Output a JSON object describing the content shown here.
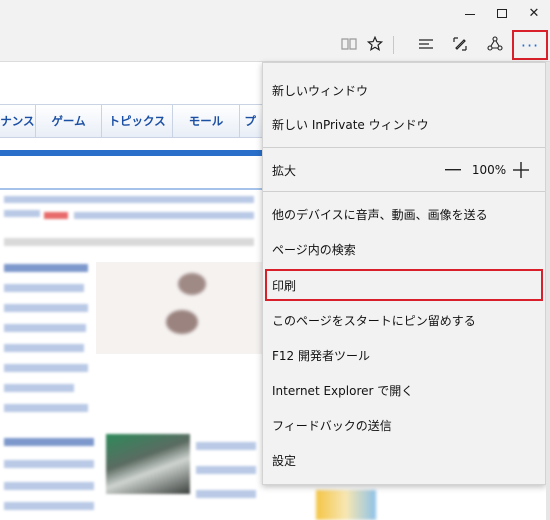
{
  "browser": {
    "window_controls": {
      "minimize": "—",
      "maximize": "□",
      "close": "✕"
    },
    "toolbar": {
      "icons": [
        "reading-view-icon",
        "favorite-star-icon",
        "hub-icon",
        "web-note-icon",
        "share-icon",
        "more-icon"
      ],
      "more_label": "···"
    }
  },
  "page": {
    "nav_tabs": [
      {
        "label": "ナンス"
      },
      {
        "label": "ゲーム"
      },
      {
        "label": "トピックス"
      },
      {
        "label": "モール"
      },
      {
        "label": "プ"
      }
    ]
  },
  "menu": {
    "new_window": "新しいウィンドウ",
    "new_inprivate": "新しい InPrivate ウィンドウ",
    "zoom": {
      "label": "拡大",
      "value": "100%",
      "minus": "—",
      "plus": "+"
    },
    "cast": "他のデバイスに音声、動画、画像を送る",
    "find": "ページ内の検索",
    "print": "印刷",
    "pin": "このページをスタートにピン留めする",
    "devtools": "F12 開発者ツール",
    "open_ie": "Internet Explorer で開く",
    "feedback": "フィードバックの送信",
    "settings": "設定"
  },
  "colors": {
    "highlight": "#d9202a",
    "accent": "#1e6fd9",
    "menu_bg": "#f2f2f2"
  }
}
